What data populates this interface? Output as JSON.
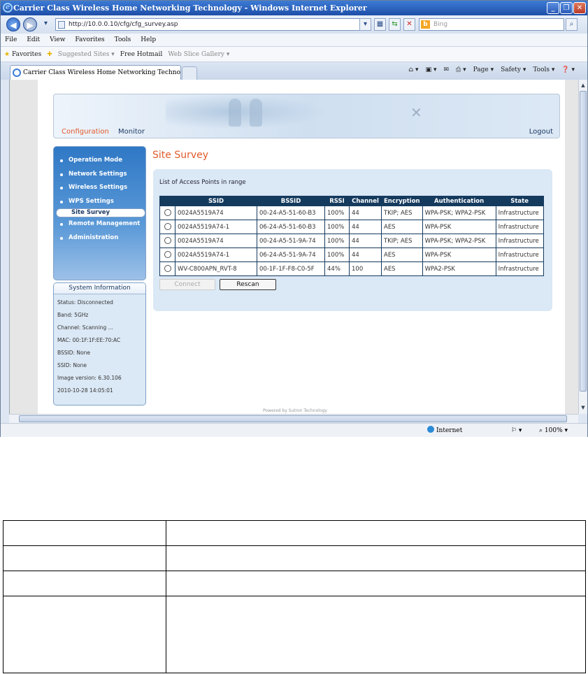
{
  "window": {
    "title": "Carrier Class Wireless Home Networking Technology - Windows Internet Explorer",
    "url": "http://10.0.0.10/cfg/cfg_survey.asp",
    "search_placeholder": "Bing",
    "minimize_glyph": "_",
    "maximize_glyph": "❐",
    "close_glyph": "✕"
  },
  "menubar": [
    "File",
    "Edit",
    "View",
    "Favorites",
    "Tools",
    "Help"
  ],
  "favorites_bar": {
    "favorites": "Favorites",
    "suggested": "Suggested Sites ▾",
    "hotmail": "Free Hotmail",
    "gallery": "Web Slice Gallery ▾"
  },
  "tab": {
    "label": "Carrier Class Wireless Home Networking Technology"
  },
  "command_bar": [
    "Page ▾",
    "Safety ▾",
    "Tools ▾"
  ],
  "statusbar": {
    "zone": "Internet",
    "zoom": "100%"
  },
  "header": {
    "configuration": "Configuration",
    "monitor": "Monitor",
    "logout": "Logout"
  },
  "menu": [
    {
      "label": "Operation Mode",
      "active": false
    },
    {
      "label": "Network Settings",
      "active": false
    },
    {
      "label": "Wireless Settings",
      "active": false
    },
    {
      "label": "WPS Settings",
      "active": false
    },
    {
      "label": "Site Survey",
      "active": true
    },
    {
      "label": "Remote Management",
      "active": false
    },
    {
      "label": "Administration",
      "active": false
    }
  ],
  "system_info": {
    "title": "System Information",
    "lines": [
      "Status: Disconnected",
      "Band: 5GHz",
      "Channel: Scanning ...",
      "MAC: 00:1F:1F:EE:70:AC",
      "BSSID: None",
      "SSID: None",
      "Image version: 6.30.106",
      "2010-10-28 14:05:01"
    ]
  },
  "page_title": "Site Survey",
  "survey": {
    "caption": "List of Access Points in range",
    "columns": [
      "",
      "SSID",
      "BSSID",
      "RSSI",
      "Channel",
      "Encryption",
      "Authentication",
      "State"
    ],
    "rows": [
      [
        "0024A5519A74",
        "00-24-A5-51-60-B3",
        "100%",
        "44",
        "TKIP; AES",
        "WPA-PSK; WPA2-PSK",
        "Infrastructure"
      ],
      [
        "0024A5519A74-1",
        "06-24-A5-51-60-B3",
        "100%",
        "44",
        "AES",
        "WPA-PSK",
        "Infrastructure"
      ],
      [
        "0024A5519A74",
        "00-24-A5-51-9A-74",
        "100%",
        "44",
        "TKIP; AES",
        "WPA-PSK; WPA2-PSK",
        "Infrastructure"
      ],
      [
        "0024A5519A74-1",
        "06-24-A5-51-9A-74",
        "100%",
        "44",
        "AES",
        "WPA-PSK",
        "Infrastructure"
      ],
      [
        "WV-C800APN_RVT-8",
        "00-1F-1F-F8-C0-5F",
        "44%",
        "100",
        "AES",
        "WPA2-PSK",
        "Infrastructure"
      ]
    ],
    "connect_label": "Connect",
    "rescan_label": "Rescan"
  },
  "footer_text": "Powered by Sutron Technology"
}
